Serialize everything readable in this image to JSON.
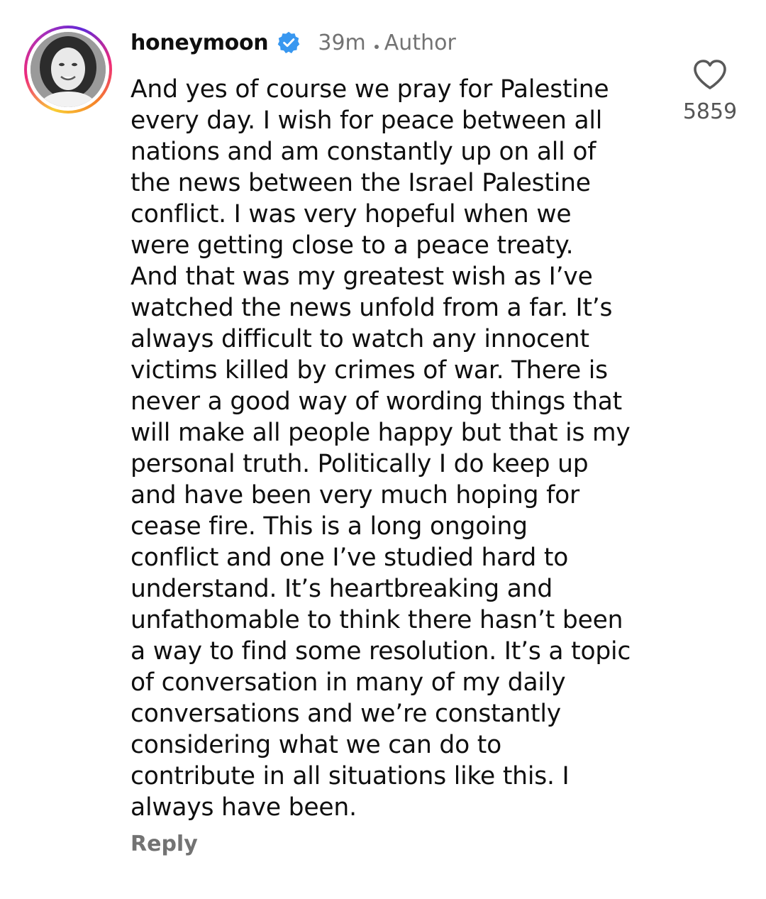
{
  "comment": {
    "username": "honeymoon",
    "verified_icon": "verified-badge-icon",
    "time": "39m",
    "author_label": "Author",
    "text_lines": [
      "And yes of course we pray for Palestine",
      "every day. I wish for peace between all",
      "nations and am constantly up on all of",
      "the news between the Israel Palestine",
      "conflict. I was very hopeful when we",
      "were getting close to a peace treaty.",
      "And that was my greatest wish as I’ve",
      "watched the news unfold from a far. It’s",
      "always difficult to watch any innocent",
      "victims killed by crimes of war. There is",
      "never a good way of wording things that",
      "will make all people happy but that is my",
      "personal truth. Politically I do keep up",
      "and have been very much hoping for",
      "cease fire.  This is a long ongoing",
      "conflict and one I’ve studied hard to",
      "understand. It’s heartbreaking and",
      "unfathomable to think there hasn’t been",
      "a way to find some resolution. It’s a topic",
      "of conversation in many of my daily",
      "conversations and we’re constantly",
      "considering what we can do to",
      "contribute in all situations like this. I",
      "always have been."
    ],
    "reply_label": "Reply",
    "like_icon": "heart-outline-icon",
    "like_count": "5859"
  },
  "colors": {
    "verified": "#3897f0",
    "secondary_text": "#737373",
    "primary_text": "#0f0f0f"
  }
}
